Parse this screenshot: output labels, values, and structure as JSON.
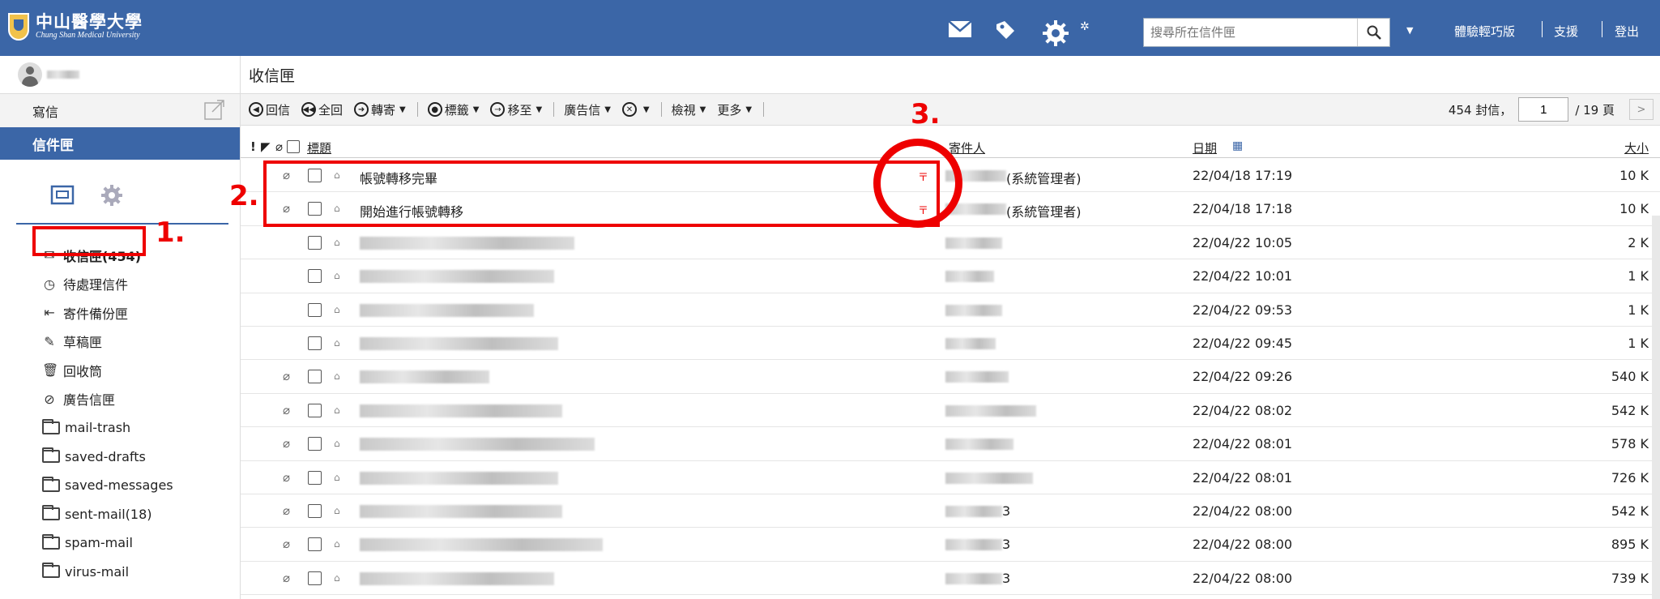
{
  "brand": {
    "title": "中山醫學大學",
    "subtitle": "Chung Shan Medical University"
  },
  "topbar": {
    "search_placeholder": "搜尋所在信件匣",
    "links": [
      "體驗輕巧版",
      "支援",
      "登出"
    ]
  },
  "sidebar": {
    "compose_label": "寫信",
    "inbox_tab_label": "信件匣",
    "folders": [
      {
        "label": "收信匣(454)",
        "icon": "inbox-icon"
      },
      {
        "label": "待處理信件",
        "icon": "clock-icon"
      },
      {
        "label": "寄件備份匣",
        "icon": "sent-icon"
      },
      {
        "label": "草稿匣",
        "icon": "edit-icon"
      },
      {
        "label": "回收筒",
        "icon": "trash-icon"
      },
      {
        "label": "廣告信匣",
        "icon": "spam-folder-icon"
      },
      {
        "label": "mail-trash",
        "icon": "folder-icon"
      },
      {
        "label": "saved-drafts",
        "icon": "folder-icon"
      },
      {
        "label": "saved-messages",
        "icon": "folder-icon"
      },
      {
        "label": "sent-mail(18)",
        "icon": "folder-icon"
      },
      {
        "label": "spam-mail",
        "icon": "folder-icon"
      },
      {
        "label": "virus-mail",
        "icon": "folder-icon"
      }
    ]
  },
  "main": {
    "title": "收信匣",
    "toolbar": {
      "reply": "回信",
      "reply_all": "全回",
      "forward": "轉寄",
      "tag": "標籤",
      "move": "移至",
      "spam": "廣告信",
      "view": "檢視",
      "more": "更多"
    },
    "pager": {
      "count": "454 封信，",
      "page": "1",
      "total": "/ 19 頁"
    },
    "columns": {
      "subject": "標題",
      "from": "寄件人",
      "date": "日期",
      "size": "大小"
    },
    "messages": [
      {
        "subject": "帳號轉移完畢",
        "from": "(系統管理者)",
        "date": "22/04/18 17:19",
        "size": "10 K",
        "priority": "〒"
      },
      {
        "subject": "開始進行帳號轉移",
        "from": "(系統管理者)",
        "date": "22/04/18 17:18",
        "size": "10 K",
        "priority": "〒"
      },
      {
        "subject": "",
        "from": "",
        "date": "22/04/22 10:05",
        "size": "2 K",
        "priority": ""
      },
      {
        "subject": "",
        "from": "",
        "date": "22/04/22 10:01",
        "size": "1 K",
        "priority": ""
      },
      {
        "subject": "",
        "from": "",
        "date": "22/04/22 09:53",
        "size": "1 K",
        "priority": ""
      },
      {
        "subject": "",
        "from": "",
        "date": "22/04/22 09:45",
        "size": "1 K",
        "priority": ""
      },
      {
        "subject": "",
        "from": "",
        "date": "22/04/22 09:26",
        "size": "540 K",
        "priority": ""
      },
      {
        "subject": "",
        "from": "",
        "date": "22/04/22 08:02",
        "size": "542 K",
        "priority": ""
      },
      {
        "subject": "",
        "from": "",
        "date": "22/04/22 08:01",
        "size": "578 K",
        "priority": ""
      },
      {
        "subject": "",
        "from": "",
        "date": "22/04/22 08:01",
        "size": "726 K",
        "priority": ""
      },
      {
        "subject": "",
        "from": "3",
        "date": "22/04/22 08:00",
        "size": "542 K",
        "priority": ""
      },
      {
        "subject": "",
        "from": "3",
        "date": "22/04/22 08:00",
        "size": "895 K",
        "priority": ""
      },
      {
        "subject": "",
        "from": "3",
        "date": "22/04/22 08:00",
        "size": "739 K",
        "priority": ""
      }
    ]
  },
  "annotations": {
    "step1": "1.",
    "step2": "2.",
    "step3": "3."
  },
  "colors": {
    "brand_blue": "#3b66a7",
    "annotation_red": "#e00000"
  }
}
